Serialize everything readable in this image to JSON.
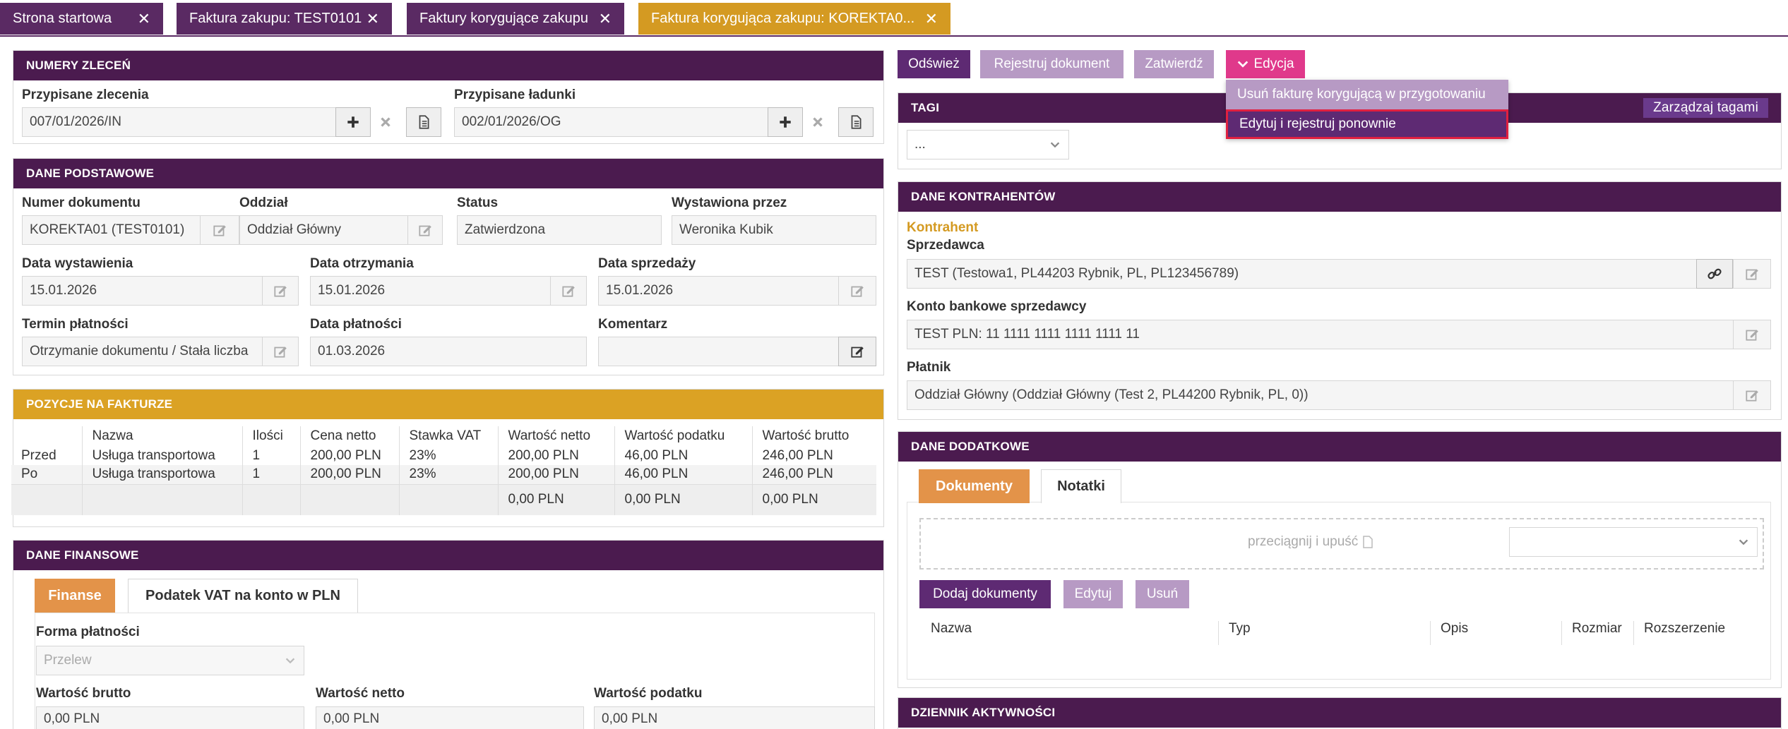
{
  "tabs": [
    {
      "label": "Strona startowa"
    },
    {
      "label": "Faktura zakupu: TEST0101"
    },
    {
      "label": "Faktury korygujące zakupu"
    },
    {
      "label": "Faktura korygująca zakupu: KOREKTA0..."
    }
  ],
  "close_glyph": "✕",
  "numery": {
    "title": "NUMERY ZLECEŃ",
    "zlecenia_label": "Przypisane zlecenia",
    "zlecenia_value": "007/01/2026/IN",
    "ladunki_label": "Przypisane ładunki",
    "ladunki_value": "002/01/2026/OG"
  },
  "podstawowe": {
    "title": "DANE PODSTAWOWE",
    "numer_label": "Numer dokumentu",
    "numer_value": "KOREKTA01 (TEST0101)",
    "oddzial_label": "Oddział",
    "oddzial_value": "Oddział Główny",
    "status_label": "Status",
    "status_value": "Zatwierdzona",
    "wystawiona_label": "Wystawiona przez",
    "wystawiona_value": "Weronika Kubik",
    "data_wyst_label": "Data wystawienia",
    "data_wyst_value": "15.01.2026",
    "data_otrz_label": "Data otrzymania",
    "data_otrz_value": "15.01.2026",
    "data_sprz_label": "Data sprzedaży",
    "data_sprz_value": "15.01.2026",
    "termin_label": "Termin płatności",
    "termin_value": "Otrzymanie dokumentu / Stała liczba",
    "data_plat_label": "Data płatności",
    "data_plat_value": "01.03.2026",
    "komentarz_label": "Komentarz",
    "komentarz_value": ""
  },
  "pozycje": {
    "title": "POZYCJE NA FAKTURZE",
    "headers": [
      "",
      "Nazwa",
      "Ilości",
      "Cena netto",
      "Stawka VAT",
      "Wartość netto",
      "Wartość podatku",
      "Wartość brutto"
    ],
    "rows": [
      [
        "Przed",
        "Usługa transportowa",
        "1",
        "200,00 PLN",
        "23%",
        "200,00 PLN",
        "46,00 PLN",
        "246,00 PLN"
      ],
      [
        "Po",
        "Usługa transportowa",
        "1",
        "200,00 PLN",
        "23%",
        "200,00 PLN",
        "46,00 PLN",
        "246,00 PLN"
      ]
    ],
    "sum": [
      "",
      "",
      "",
      "",
      "",
      "0,00 PLN",
      "0,00 PLN",
      "0,00 PLN"
    ]
  },
  "finansowe": {
    "title": "DANE FINANSOWE",
    "tab_finanse": "Finanse",
    "tab_vat": "Podatek VAT na konto w PLN",
    "forma_label": "Forma płatności",
    "forma_value": "Przelew",
    "brutto_label": "Wartość brutto",
    "brutto_value": "0,00 PLN",
    "netto_label": "Wartość netto",
    "netto_value": "0,00 PLN",
    "podatek_label": "Wartość podatku",
    "podatek_value": "0,00 PLN"
  },
  "toolbar": {
    "odswiez": "Odśwież",
    "rejestruj": "Rejestruj dokument",
    "zatwierdz": "Zatwierdź",
    "edycja": "Edycja"
  },
  "edycja_menu": {
    "item1": "Usuń fakturę korygującą w przygotowaniu",
    "item2": "Edytuj i rejestruj ponownie"
  },
  "tagi": {
    "title": "TAGI",
    "manage": "Zarządzaj tagami",
    "select_value": "..."
  },
  "kontrahenci": {
    "title": "DANE KONTRAHENTÓW",
    "kontrahent": "Kontrahent",
    "sprzedawca_label": "Sprzedawca",
    "sprzedawca_value": "TEST (Testowa1, PL44203 Rybnik, PL, PL123456789)",
    "konto_label": "Konto bankowe sprzedawcy",
    "konto_value": "TEST PLN: 11 1111 1111 1111 1111 11",
    "platnik_label": "Płatnik",
    "platnik_value": "Oddział Główny  (Oddział Główny  (Test 2, PL44200 Rybnik, PL, 0))"
  },
  "dodatkowe": {
    "title": "DANE DODATKOWE",
    "tab_dokumenty": "Dokumenty",
    "tab_notatki": "Notatki",
    "drop_text": "przeciągnij i upuść",
    "btn_dodaj": "Dodaj dokumenty",
    "btn_edytuj": "Edytuj",
    "btn_usun": "Usuń",
    "headers": [
      "Nazwa",
      "Typ",
      "Opis",
      "Rozmiar",
      "Rozszerzenie"
    ]
  },
  "dziennik": {
    "title": "DZIENNIK AKTYWNOŚCI"
  },
  "colors": {
    "purple_dark": "#4b1b4f",
    "purple_button": "#5e2a73",
    "purple_light": "#b79ac4",
    "orange": "#dba224",
    "pink": "#e0398b",
    "active_tab": "#d49a22"
  }
}
